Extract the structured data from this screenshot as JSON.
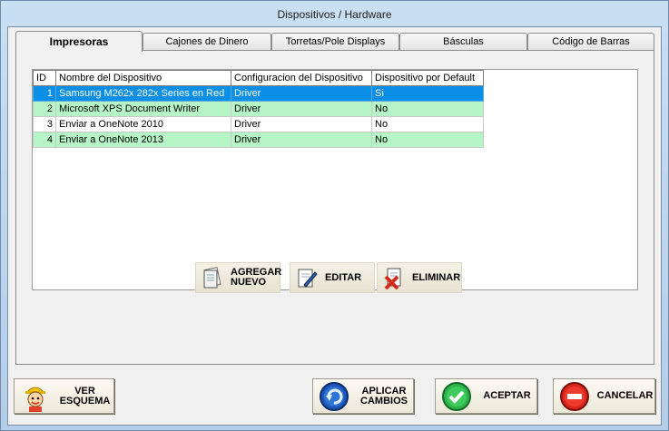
{
  "window": {
    "title": "Dispositivos / Hardware"
  },
  "tabs": [
    {
      "label": "Impresoras",
      "active": true
    },
    {
      "label": "Cajones de Dinero"
    },
    {
      "label": "Torretas/Pole Displays"
    },
    {
      "label": "Básculas"
    },
    {
      "label": "Código de Barras"
    }
  ],
  "grid": {
    "columns": [
      "ID",
      "Nombre del Dispositivo",
      "Configuracion del Dispositivo",
      "Dispositivo por Default"
    ],
    "rows": [
      {
        "id": "1",
        "name": "Samsung M262x 282x Series en Red",
        "config": "Driver",
        "default": "Si"
      },
      {
        "id": "2",
        "name": "Microsoft XPS Document Writer",
        "config": "Driver",
        "default": "No"
      },
      {
        "id": "3",
        "name": "Enviar a OneNote 2010",
        "config": "Driver",
        "default": "No"
      },
      {
        "id": "4",
        "name": "Enviar a OneNote 2013",
        "config": "Driver",
        "default": "No"
      }
    ]
  },
  "actions": {
    "add_line1": "AGREGAR",
    "add_line2": "NUEVO",
    "edit": "EDITAR",
    "delete": "ELIMINAR"
  },
  "footer": {
    "schema_line1": "VER",
    "schema_line2": "ESQUEMA",
    "apply_line1": "APLICAR",
    "apply_line2": "CAMBIOS",
    "accept": "ACEPTAR",
    "cancel": "CANCELAR"
  },
  "colors": {
    "selected_row": "#0a8ee6",
    "alt_row": "#b6f5c6",
    "accept_icon": "#2db34a",
    "cancel_icon": "#d9261c",
    "apply_icon": "#1d56b8"
  },
  "icons": [
    "document-add-icon",
    "edit-pencil-icon",
    "delete-x-icon",
    "construction-worker-icon",
    "refresh-arrow-icon",
    "check-icon",
    "stop-icon"
  ]
}
